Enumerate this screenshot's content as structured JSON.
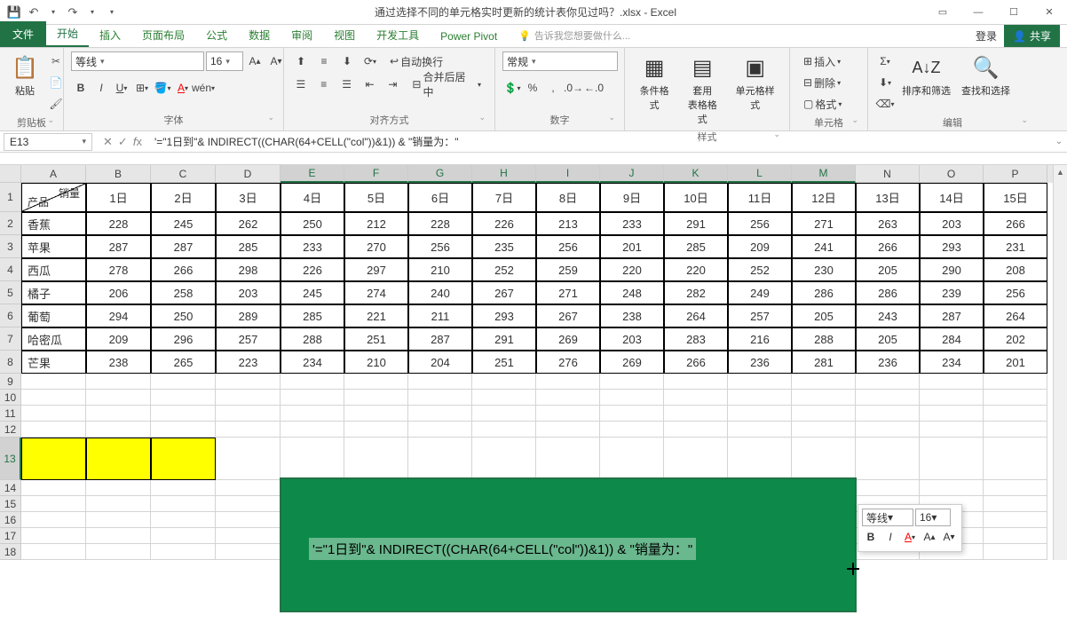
{
  "title": "通过选择不同的单元格实时更新的统计表你见过吗？.xlsx - Excel",
  "tabs": {
    "file": "文件",
    "home": "开始",
    "insert": "插入",
    "layout": "页面布局",
    "formulas": "公式",
    "data": "数据",
    "review": "审阅",
    "view": "视图",
    "dev": "开发工具",
    "powerpivot": "Power Pivot",
    "tell": "告诉我您想要做什么..."
  },
  "login": "登录",
  "share": "共享",
  "ribbon": {
    "clipboard": {
      "paste": "粘贴",
      "label": "剪贴板"
    },
    "font": {
      "name": "等线",
      "size": "16",
      "label": "字体"
    },
    "align": {
      "wrap": "自动换行",
      "merge": "合并后居中",
      "label": "对齐方式"
    },
    "number": {
      "format": "常规",
      "label": "数字"
    },
    "styles": {
      "cond": "条件格式",
      "table": "套用\n表格格式",
      "cell": "单元格样式",
      "label": "样式"
    },
    "cells": {
      "insert": "插入",
      "delete": "删除",
      "format": "格式",
      "label": "单元格"
    },
    "editing": {
      "sort": "排序和筛选",
      "find": "查找和选择",
      "label": "编辑"
    }
  },
  "namebox": "E13",
  "formula": "'=\"1日到\"& INDIRECT((CHAR(64+CELL(\"col\"))&1)) & \"销量为：\"",
  "cols": [
    "A",
    "B",
    "C",
    "D",
    "E",
    "F",
    "G",
    "H",
    "I",
    "J",
    "K",
    "L",
    "M",
    "N",
    "O",
    "P"
  ],
  "diag": {
    "tr": "销量",
    "bl": "产品"
  },
  "headers": [
    "1日",
    "2日",
    "3日",
    "4日",
    "5日",
    "6日",
    "7日",
    "8日",
    "9日",
    "10日",
    "11日",
    "12日",
    "13日",
    "14日",
    "15日"
  ],
  "products": [
    "香蕉",
    "苹果",
    "西瓜",
    "橘子",
    "葡萄",
    "哈密瓜",
    "芒果"
  ],
  "data": [
    [
      228,
      245,
      262,
      250,
      212,
      228,
      226,
      213,
      233,
      291,
      256,
      271,
      263,
      203,
      266
    ],
    [
      287,
      287,
      285,
      233,
      270,
      256,
      235,
      256,
      201,
      285,
      209,
      241,
      266,
      293,
      231
    ],
    [
      278,
      266,
      298,
      226,
      297,
      210,
      252,
      259,
      220,
      220,
      252,
      230,
      205,
      290,
      208
    ],
    [
      206,
      258,
      203,
      245,
      274,
      240,
      267,
      271,
      248,
      282,
      249,
      286,
      286,
      239,
      256
    ],
    [
      294,
      250,
      289,
      285,
      221,
      211,
      293,
      267,
      238,
      264,
      257,
      205,
      243,
      287,
      264
    ],
    [
      209,
      296,
      257,
      288,
      251,
      287,
      291,
      269,
      203,
      283,
      216,
      288,
      205,
      284,
      202
    ],
    [
      238,
      265,
      223,
      234,
      210,
      204,
      251,
      276,
      269,
      266,
      236,
      281,
      236,
      234,
      201
    ]
  ],
  "green_text": "'=\"1日到\"& INDIRECT((CHAR(64+CELL(\"col\"))&1)) & \"销量为：\"",
  "mini": {
    "font": "等线",
    "size": "16"
  }
}
